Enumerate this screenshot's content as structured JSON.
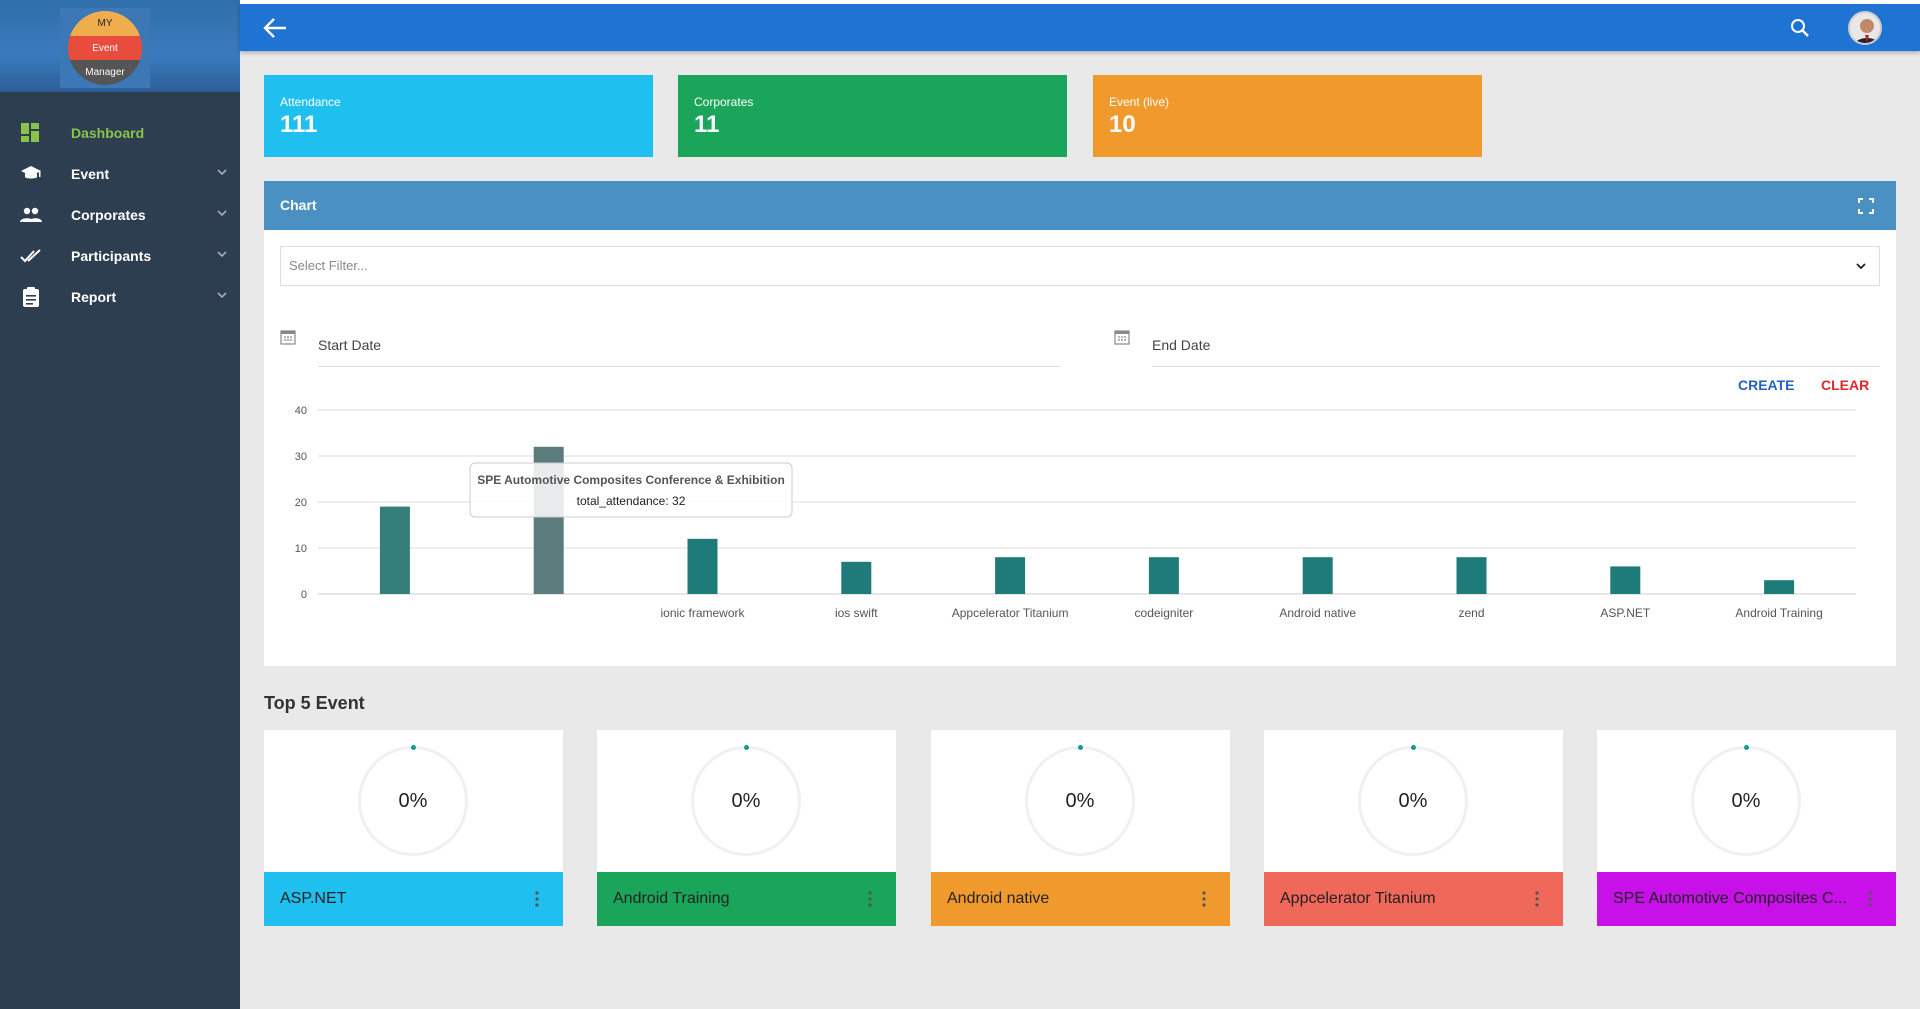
{
  "logo": {
    "line1": "MY",
    "line2": "Event",
    "line3": "Manager"
  },
  "sidebar": {
    "items": [
      {
        "label": "Dashboard",
        "icon": "dashboard-icon"
      },
      {
        "label": "Event",
        "icon": "graduation-cap-icon"
      },
      {
        "label": "Corporates",
        "icon": "people-icon"
      },
      {
        "label": "Participants",
        "icon": "double-check-icon"
      },
      {
        "label": "Report",
        "icon": "clipboard-icon"
      }
    ]
  },
  "stats": [
    {
      "label": "Attendance",
      "value": "111",
      "color": "#1fbfef"
    },
    {
      "label": "Corporates",
      "value": "11",
      "color": "#1aa55a"
    },
    {
      "label": "Event (live)",
      "value": "10",
      "color": "#f09a2e"
    }
  ],
  "chart_panel": {
    "title": "Chart",
    "filter_placeholder": "Select Filter...",
    "start_date": "Start Date",
    "end_date": "End Date",
    "create_label": "CREATE",
    "clear_label": "CLEAR",
    "tooltip_title": "SPE Automotive Composites Conference & Exhibition",
    "tooltip_value": "total_attendance: 32"
  },
  "chart_data": {
    "type": "bar",
    "categories": [
      "",
      "",
      "ionic framework",
      "ios swift",
      "Appcelerator Titanium",
      "codeigniter",
      "Android native",
      "zend",
      "ASP.NET",
      "Android Training"
    ],
    "values": [
      19,
      32,
      12,
      7,
      8,
      8,
      8,
      8,
      6,
      3
    ],
    "ylim": [
      0,
      40
    ],
    "yticks": [
      "0",
      "10",
      "20",
      "30",
      "40"
    ],
    "grid": true,
    "color": "#1e7b7a"
  },
  "top5": {
    "title": "Top 5 Event",
    "events": [
      {
        "name": "ASP.NET",
        "percent": "0%",
        "color": "#1fbfef"
      },
      {
        "name": "Android Training",
        "percent": "0%",
        "color": "#1aa55a"
      },
      {
        "name": "Android native",
        "percent": "0%",
        "color": "#f09a2e"
      },
      {
        "name": "Appcelerator Titanium",
        "percent": "0%",
        "color": "#f0685a"
      },
      {
        "name": "SPE Automotive Composites C...",
        "percent": "0%",
        "color": "#c810e8"
      }
    ]
  }
}
